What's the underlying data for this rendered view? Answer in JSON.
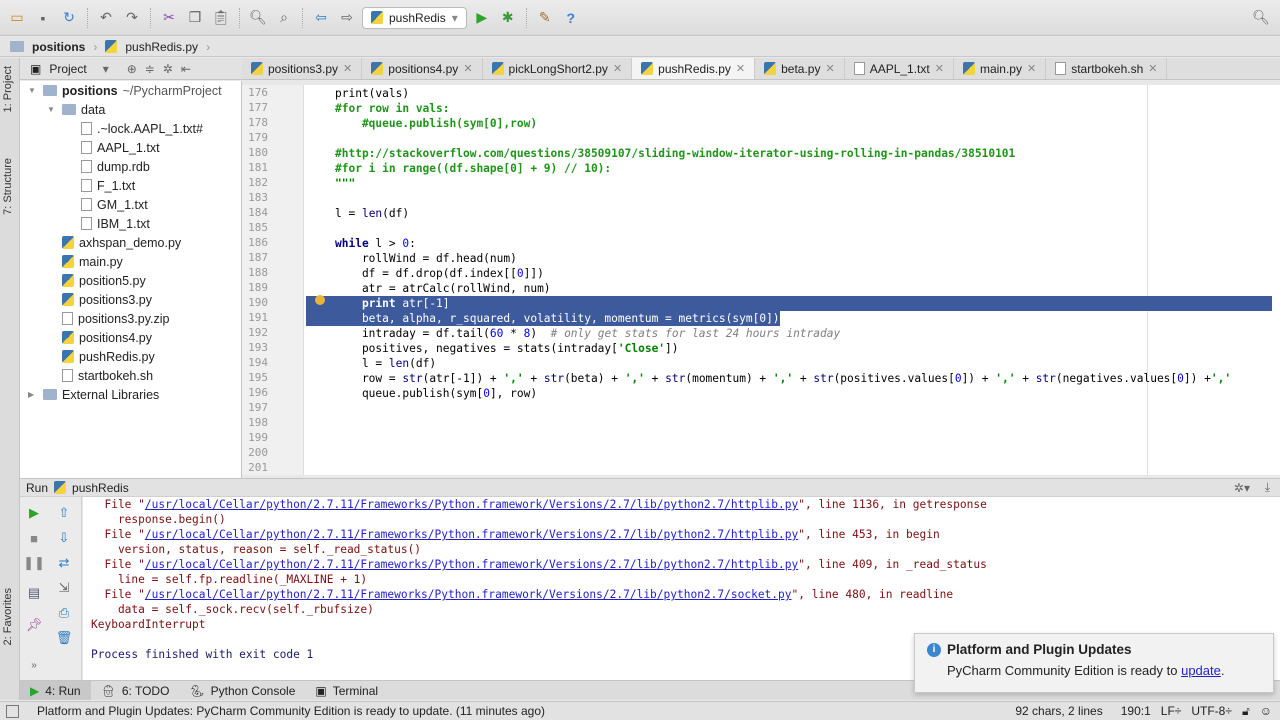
{
  "toolbar": {
    "run_config": "pushRedis",
    "icons": [
      "open-folder-icon",
      "save-icon",
      "sync-icon",
      "undo-icon",
      "redo-icon",
      "cut-icon",
      "copy-icon",
      "paste-icon",
      "find-icon",
      "replace-icon",
      "back-icon",
      "forward-icon"
    ]
  },
  "breadcrumb": [
    "positions",
    "pushRedis.py"
  ],
  "left_strip": {
    "project": "1: Project",
    "structure": "7: Structure",
    "favorites": "2: Favorites"
  },
  "project_panel": {
    "title": "Project",
    "tree": [
      {
        "label": "positions",
        "suffix": "~/PycharmProject",
        "type": "folder",
        "depth": 0,
        "open": true
      },
      {
        "label": "data",
        "type": "folder",
        "depth": 1,
        "open": true
      },
      {
        "label": ".~lock.AAPL_1.txt#",
        "type": "file",
        "depth": 2
      },
      {
        "label": "AAPL_1.txt",
        "type": "file",
        "depth": 2
      },
      {
        "label": "dump.rdb",
        "type": "file",
        "depth": 2
      },
      {
        "label": "F_1.txt",
        "type": "file",
        "depth": 2
      },
      {
        "label": "GM_1.txt",
        "type": "file",
        "depth": 2
      },
      {
        "label": "IBM_1.txt",
        "type": "file",
        "depth": 2
      },
      {
        "label": "axhspan_demo.py",
        "type": "py",
        "depth": 1
      },
      {
        "label": "main.py",
        "type": "py",
        "depth": 1
      },
      {
        "label": "position5.py",
        "type": "py",
        "depth": 1
      },
      {
        "label": "positions3.py",
        "type": "py",
        "depth": 1
      },
      {
        "label": "positions3.py.zip",
        "type": "zip",
        "depth": 1
      },
      {
        "label": "positions4.py",
        "type": "py",
        "depth": 1
      },
      {
        "label": "pushRedis.py",
        "type": "py",
        "depth": 1
      },
      {
        "label": "startbokeh.sh",
        "type": "file",
        "depth": 1
      },
      {
        "label": "External Libraries",
        "type": "lib",
        "depth": 0,
        "open": false
      }
    ]
  },
  "tabs": [
    {
      "label": "positions3.py"
    },
    {
      "label": "positions4.py"
    },
    {
      "label": "pickLongShort2.py"
    },
    {
      "label": "pushRedis.py",
      "active": true
    },
    {
      "label": "beta.py"
    },
    {
      "label": "AAPL_1.txt"
    },
    {
      "label": "main.py"
    },
    {
      "label": "startbokeh.sh"
    }
  ],
  "editor": {
    "first_line": 176,
    "selected_lines": [
      190,
      191
    ],
    "lines": [
      [
        [
          "",
          "print(vals)"
        ]
      ],
      [
        [
          "cm",
          "#for row in vals:"
        ]
      ],
      [
        [
          "cm",
          "    #queue.publish(sym[0],row)"
        ]
      ],
      [],
      [
        [
          "cm",
          "#http://stackoverflow.com/questions/38509107/sliding-window-iterator-using-rolling-in-pandas/38510101"
        ]
      ],
      [
        [
          "cm",
          "#for i in range((df.shape[0] + 9) // 10):"
        ]
      ],
      [
        [
          "st",
          "\"\"\""
        ]
      ],
      [],
      [
        [
          "",
          "l = "
        ],
        [
          "bi",
          "len"
        ],
        [
          "",
          "(df)"
        ]
      ],
      [],
      [
        [
          "kw",
          "while"
        ],
        [
          "",
          " l > "
        ],
        [
          "nm",
          "0"
        ],
        [
          "",
          ":"
        ]
      ],
      [
        [
          "",
          "    rollWind = df.head(num)"
        ]
      ],
      [
        [
          "",
          "    df = df.drop(df.index[["
        ],
        [
          "nm",
          "0"
        ],
        [
          "",
          "]])"
        ]
      ],
      [
        [
          "",
          "    atr = atrCalc(rollWind, num)"
        ]
      ],
      [
        [
          "",
          "    "
        ],
        [
          "kw",
          "print"
        ],
        [
          "",
          " atr[-1]"
        ]
      ],
      [
        [
          "",
          "    beta, alpha, r_squared, volatility, momentum = metrics(sym[0])"
        ]
      ],
      [
        [
          "",
          "    intraday = df.tail("
        ],
        [
          "nm",
          "60"
        ],
        [
          "",
          " * "
        ],
        [
          "nm",
          "8"
        ],
        [
          "",
          ")  "
        ],
        [
          "cmi",
          "# only get stats for last 24 hours intraday"
        ]
      ],
      [
        [
          "",
          "    positives, negatives = stats(intraday["
        ],
        [
          "st",
          "'Close'"
        ],
        [
          "",
          "])"
        ]
      ],
      [
        [
          "",
          "    l = "
        ],
        [
          "bi",
          "len"
        ],
        [
          "",
          "(df)"
        ]
      ],
      [
        [
          "",
          "    row = "
        ],
        [
          "bi",
          "str"
        ],
        [
          "",
          "(atr[-1]) + "
        ],
        [
          "st",
          "','"
        ],
        [
          "",
          " + "
        ],
        [
          "bi",
          "str"
        ],
        [
          "",
          "(beta) + "
        ],
        [
          "st",
          "','"
        ],
        [
          "",
          " + "
        ],
        [
          "bi",
          "str"
        ],
        [
          "",
          "(momentum) + "
        ],
        [
          "st",
          "','"
        ],
        [
          "",
          " + "
        ],
        [
          "bi",
          "str"
        ],
        [
          "",
          "(positives.values["
        ],
        [
          "nm",
          "0"
        ],
        [
          "",
          "]) + "
        ],
        [
          "st",
          "','"
        ],
        [
          "",
          " + "
        ],
        [
          "bi",
          "str"
        ],
        [
          "",
          "(negatives.values["
        ],
        [
          "nm",
          "0"
        ],
        [
          "",
          "]) +"
        ],
        [
          "st",
          "','"
        ]
      ],
      [
        [
          "",
          "    queue.publish(sym["
        ],
        [
          "nm",
          "0"
        ],
        [
          "",
          "], row)"
        ]
      ],
      [],
      [],
      [],
      [],
      []
    ]
  },
  "run_panel": {
    "label": "Run",
    "config": "pushRedis",
    "console": [
      {
        "pre": "  File \"",
        "link": "/usr/local/Cellar/python/2.7.11/Frameworks/Python.framework/Versions/2.7/lib/python2.7/httplib.py",
        "post": "\", line 1136, in getresponse"
      },
      {
        "pre": "    response.begin()"
      },
      {
        "pre": "  File \"",
        "link": "/usr/local/Cellar/python/2.7.11/Frameworks/Python.framework/Versions/2.7/lib/python2.7/httplib.py",
        "post": "\", line 453, in begin"
      },
      {
        "pre": "    version, status, reason = self._read_status()"
      },
      {
        "pre": "  File \"",
        "link": "/usr/local/Cellar/python/2.7.11/Frameworks/Python.framework/Versions/2.7/lib/python2.7/httplib.py",
        "post": "\", line 409, in _read_status"
      },
      {
        "pre": "    line = self.fp.readline(_MAXLINE + 1)"
      },
      {
        "pre": "  File \"",
        "link": "/usr/local/Cellar/python/2.7.11/Frameworks/Python.framework/Versions/2.7/lib/python2.7/socket.py",
        "post": "\", line 480, in readline"
      },
      {
        "pre": "    data = self._sock.recv(self._rbufsize)"
      },
      {
        "pre": "KeyboardInterrupt"
      },
      {
        "pre": ""
      },
      {
        "pre": "Process finished with exit code 1",
        "cls": "exit"
      }
    ]
  },
  "bottom_tabs": [
    {
      "label": "4: Run",
      "active": true
    },
    {
      "label": "6: TODO"
    },
    {
      "label": "Python Console"
    },
    {
      "label": "Terminal"
    }
  ],
  "notification": {
    "title": "Platform and Plugin Updates",
    "text": "PyCharm Community Edition is ready to ",
    "link": "update",
    "end": "."
  },
  "status_bar": {
    "message": "Platform and Plugin Updates: PyCharm Community Edition is ready to update. (11 minutes ago)",
    "selection": "92 chars, 2 lines",
    "position": "190:1",
    "line_sep": "LF÷",
    "encoding": "UTF-8÷"
  },
  "colors": {
    "selection": "#3d5b9c",
    "comment": "#20951a",
    "keyword": "#000080",
    "console_error": "#7a0f0f",
    "link": "#1f1fd0"
  }
}
